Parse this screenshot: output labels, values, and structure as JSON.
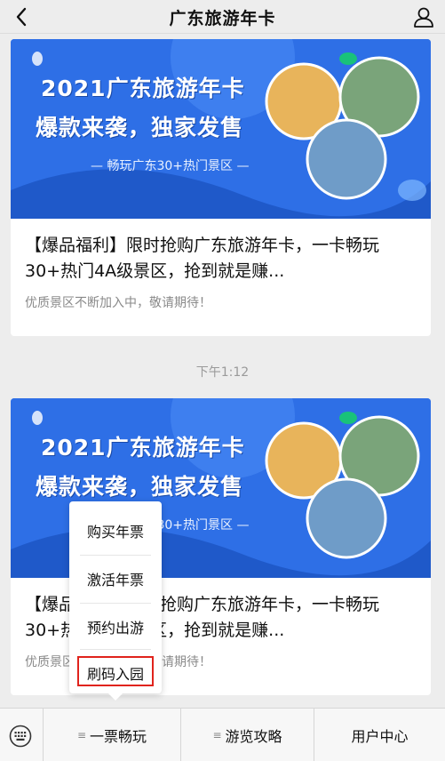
{
  "header": {
    "title": "广东旅游年卡",
    "back_icon": "chevron-left-icon",
    "user_icon": "person-icon"
  },
  "cards": [
    {
      "banner_line1": "2021广东旅游年卡",
      "banner_line2": "爆款来袭，独家发售",
      "banner_line3": "— 畅玩广东30+热门景区 —",
      "title": "【爆品福利】限时抢购广东旅游年卡，一卡畅玩30+热门4A级景区，抢到就是赚...",
      "desc": "优质景区不断加入中，敬请期待！"
    },
    {
      "banner_line1": "2021广东旅游年卡",
      "banner_line2": "爆款来袭，独家发售",
      "banner_line3": "— 畅玩广东30+热门景区 —",
      "title": "【爆品福利】限时抢购广东旅游年卡，一卡畅玩30+热门4A级景区，抢到就是赚...",
      "desc": "优质景区不断加入中，敬请期待！"
    }
  ],
  "timestamp": "下午1:12",
  "popup_menu": {
    "items": [
      "购买年票",
      "激活年票",
      "预约出游",
      "刷码入园"
    ],
    "highlighted_index": 3
  },
  "bottom_bar": {
    "keyboard_icon": "keyboard-icon",
    "tabs": [
      "一票畅玩",
      "游览攻略",
      "用户中心"
    ]
  },
  "colors": {
    "banner_blue": "#2e6fe6",
    "highlight_red": "#e0231c",
    "background": "#ededed"
  }
}
